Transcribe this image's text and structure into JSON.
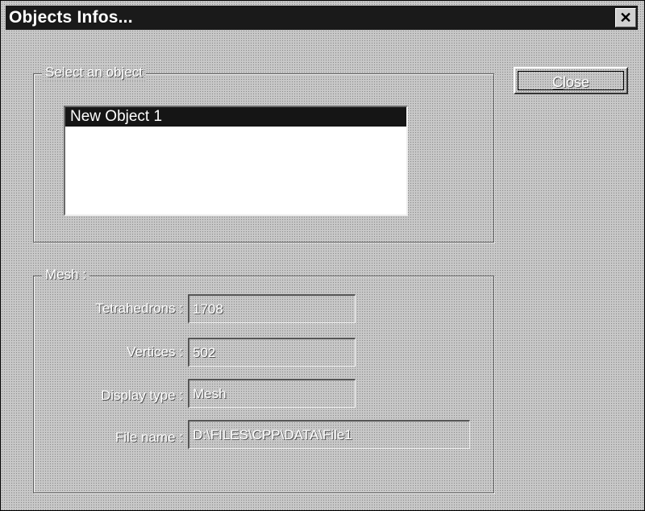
{
  "window": {
    "title": "Objects Infos...",
    "close_glyph": "✕"
  },
  "buttons": {
    "close_label_underlined": "C",
    "close_label_rest": "lose"
  },
  "select_group": {
    "label": "Select an object",
    "items": [
      {
        "label": "New Object 1",
        "selected": true
      }
    ]
  },
  "mesh_group": {
    "label": "Mesh :",
    "fields": [
      {
        "label": "Tetrahedrons :",
        "value": "1708"
      },
      {
        "label": "Vertices :",
        "value": "502"
      },
      {
        "label": "Display type :",
        "value": "Mesh"
      },
      {
        "label": "File name :",
        "value": "D:\\FILES\\CPP\\DATA\\File1"
      }
    ]
  }
}
